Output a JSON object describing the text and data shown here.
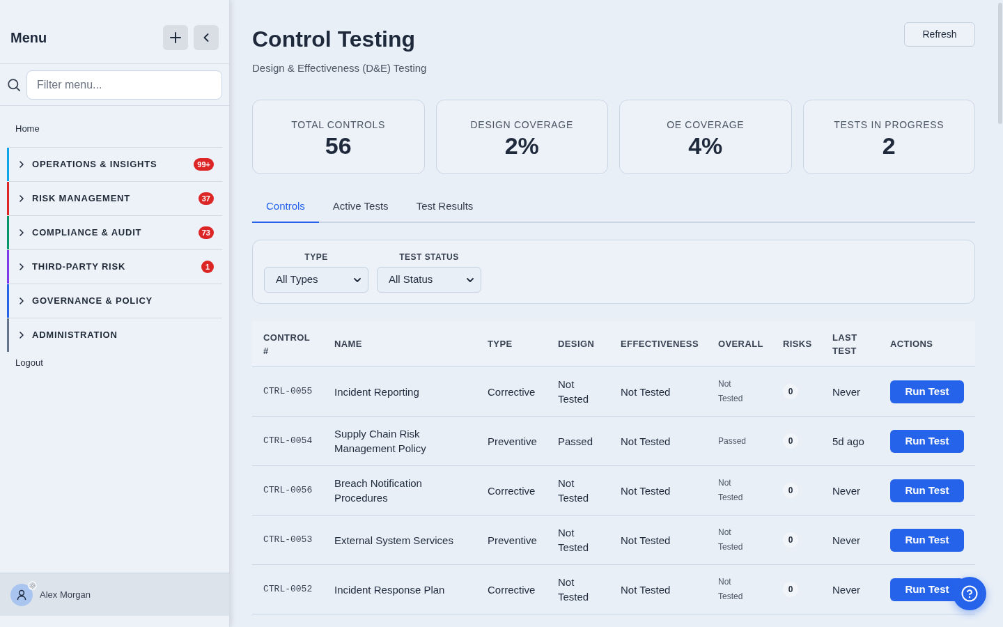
{
  "sidebar": {
    "title": "Menu",
    "search": {
      "placeholder": "Filter menu..."
    },
    "home": "Home",
    "sections": [
      {
        "label": "OPERATIONS & INSIGHTS",
        "color": "#0ea5e9",
        "badge": "99+",
        "expanded": false
      },
      {
        "label": "RISK MANAGEMENT",
        "color": "#dc2626",
        "badge": "37",
        "expanded": false
      },
      {
        "label": "COMPLIANCE & AUDIT",
        "color": "#059669",
        "badge": "73",
        "expanded": false
      },
      {
        "label": "THIRD-PARTY RISK",
        "color": "#7c3aed",
        "badge": "1",
        "expanded": false
      },
      {
        "label": "GOVERNANCE & POLICY",
        "color": "#2563eb",
        "expanded": false
      },
      {
        "label": "ADMINISTRATION",
        "color": "#64748b",
        "expanded": false
      }
    ],
    "logout": "Logout",
    "user": {
      "name": "Alex Morgan"
    }
  },
  "header": {
    "title": "Control Testing",
    "subtitle": "Design & Effectiveness (D&E) Testing",
    "refresh_button": "Refresh"
  },
  "stats": [
    {
      "label": "TOTAL CONTROLS",
      "value": "56"
    },
    {
      "label": "DESIGN COVERAGE",
      "value": "2%"
    },
    {
      "label": "OE COVERAGE",
      "value": "4%"
    },
    {
      "label": "TESTS IN PROGRESS",
      "value": "2"
    }
  ],
  "tabs": [
    {
      "label": "Controls",
      "selected": true
    },
    {
      "label": "Active Tests",
      "selected": false
    },
    {
      "label": "Test Results",
      "selected": false
    }
  ],
  "filters": [
    {
      "label": "TYPE",
      "value": "All Types"
    },
    {
      "label": "TEST STATUS",
      "value": "All Status"
    }
  ],
  "table": {
    "columns": [
      "CONTROL #",
      "NAME",
      "TYPE",
      "DESIGN",
      "EFFECTIVENESS",
      "OVERALL",
      "RISKS",
      "LAST TEST",
      "ACTIONS"
    ],
    "rows": [
      {
        "control": "CTRL-0055",
        "name": "Incident Reporting",
        "type": "Corrective",
        "design": "Not Tested",
        "effectiveness": "Not Tested",
        "overall": "Not Tested",
        "risks": "0",
        "last_test": "Never",
        "action": "Run Test"
      },
      {
        "control": "CTRL-0054",
        "name": "Supply Chain Risk Management Policy",
        "type": "Preventive",
        "design": "Passed",
        "effectiveness": "Not Tested",
        "overall": "Passed",
        "risks": "0",
        "last_test": "5d ago",
        "action": "Run Test"
      },
      {
        "control": "CTRL-0056",
        "name": "Breach Notification Procedures",
        "type": "Corrective",
        "design": "Not Tested",
        "effectiveness": "Not Tested",
        "overall": "Not Tested",
        "risks": "0",
        "last_test": "Never",
        "action": "Run Test"
      },
      {
        "control": "CTRL-0053",
        "name": "External System Services",
        "type": "Preventive",
        "design": "Not Tested",
        "effectiveness": "Not Tested",
        "overall": "Not Tested",
        "risks": "0",
        "last_test": "Never",
        "action": "Run Test"
      },
      {
        "control": "CTRL-0052",
        "name": "Incident Response Plan",
        "type": "Corrective",
        "design": "Not Tested",
        "effectiveness": "Not Tested",
        "overall": "Not Tested",
        "risks": "0",
        "last_test": "Never",
        "action": "Run Test"
      }
    ]
  }
}
